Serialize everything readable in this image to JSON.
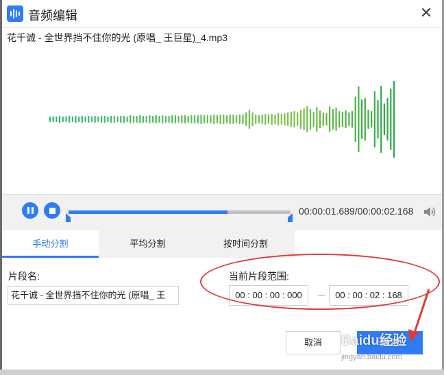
{
  "window": {
    "title": "音频编辑",
    "close_glyph": "✕"
  },
  "file": {
    "name": "花千诚 - 全世界挡不住你的光 (原唱_ 王巨星)_4.mp3"
  },
  "waveform": {
    "amplitudes": [
      3,
      3,
      3,
      4,
      3,
      3,
      4,
      3,
      4,
      3,
      4,
      3,
      4,
      3,
      4,
      3,
      4,
      4,
      3,
      4,
      4,
      3,
      4,
      4,
      3,
      5,
      4,
      4,
      5,
      4,
      4,
      5,
      4,
      5,
      4,
      5,
      4,
      4,
      5,
      5,
      4,
      5,
      5,
      4,
      5,
      5,
      5,
      6,
      5,
      5,
      5,
      6,
      5,
      6,
      6,
      5,
      6,
      6,
      5,
      6,
      6,
      9,
      13,
      9,
      6,
      5,
      6,
      7,
      6,
      7,
      6,
      8,
      7,
      8,
      9,
      10,
      11,
      9,
      13,
      15,
      18,
      14,
      10,
      17,
      12,
      9,
      8,
      18,
      14,
      16,
      11,
      10,
      12,
      9,
      11,
      32,
      47,
      28,
      30,
      13,
      11,
      40,
      27,
      48,
      22,
      30,
      44,
      55
    ],
    "colors": {
      "start": "#2bb673",
      "mid": "#7cc242",
      "end": "#2aa84a"
    }
  },
  "player": {
    "progress": 0.717,
    "time_text": "00:00:01.689/00:00:02.168",
    "pause_icon": "pause-icon",
    "stop_icon": "stop-icon",
    "volume_icon": "volume-icon"
  },
  "tabs": [
    {
      "label": "手动分割",
      "active": true
    },
    {
      "label": "平均分割",
      "active": false
    },
    {
      "label": "按时间分割",
      "active": false
    }
  ],
  "segment": {
    "name_label": "片段名:",
    "name_value": "花千诚 - 全世界挡不住你的光 (原唱_ 王",
    "range_label": "当前片段范围:",
    "start": "00 : 00 : 00 : 000",
    "end": "00 : 00 : 02 : 168"
  },
  "buttons": {
    "cancel": "取消",
    "confirm": "确定"
  },
  "watermark": {
    "main": "Baidu经验",
    "sub": "jingyan.baidu.com"
  },
  "colors": {
    "accent": "#2f7cf6",
    "annotation": "#e03a3a"
  }
}
